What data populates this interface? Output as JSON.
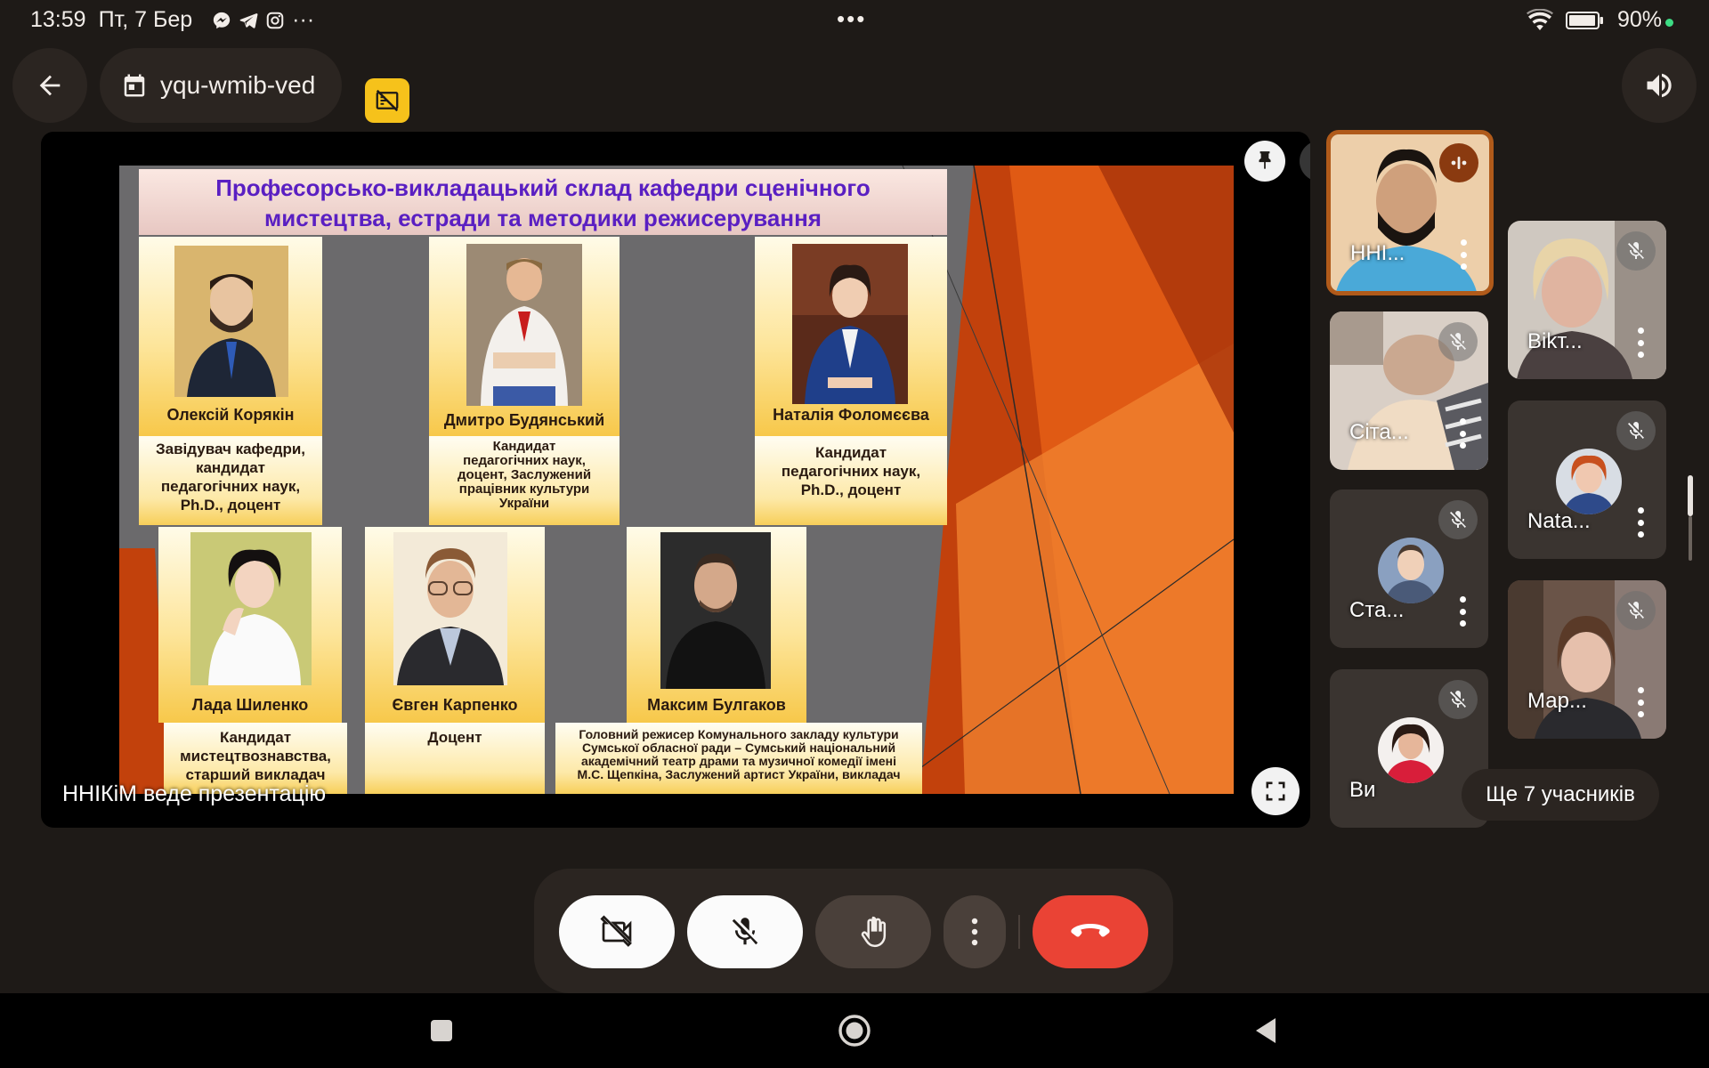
{
  "status_bar": {
    "time": "13:59",
    "date": "Пт, 7 Бер",
    "more_dots": "•••",
    "battery": "90%",
    "overflow": "···"
  },
  "meeting": {
    "code": "yqu-wmib-ved"
  },
  "presentation": {
    "presenter_label": "ННІКіМ веде презентацію",
    "slide": {
      "title_line1": "Професорсько-викладацький склад кафедри сценічного",
      "title_line2": "мистецтва, естради та методики режисерування",
      "people": [
        {
          "name": "Олексій  Корякін",
          "desc": [
            "Завідувач кафедри,",
            "кандидат",
            "педагогічних наук,",
            "Ph.D., доцент"
          ]
        },
        {
          "name": "Дмитро Будянський",
          "desc": [
            "Кандидат",
            "педагогічних наук,",
            "доцент, Заслужений",
            "працівник культури",
            "України"
          ]
        },
        {
          "name": "Наталія Фоломєєва",
          "desc": [
            "Кандидат",
            "педагогічних наук,",
            "Ph.D., доцент"
          ]
        },
        {
          "name": "Лада Шиленко",
          "desc": [
            "Кандидат",
            "мистецтвознавства,",
            "старший викладач"
          ]
        },
        {
          "name": "Євген Карпенко",
          "desc": [
            "Доцент"
          ]
        },
        {
          "name": "Максим Булгаков",
          "desc": [
            "Головний режисер Комунального закладу культури",
            "Сумської обласної ради – Сумський національний",
            "академічний театр драми та музичної комедії імені",
            "М.С. Щепкіна, Заслужений артист України, викладач"
          ]
        }
      ]
    }
  },
  "participants": [
    {
      "name": "ННІ...",
      "speaking": true
    },
    {
      "name": "Віkт..."
    },
    {
      "name": "Сіта..."
    },
    {
      "name": "Nata..."
    },
    {
      "name": "Ста..."
    },
    {
      "name": "Мар..."
    },
    {
      "name": "Ви"
    }
  ],
  "more_participants": "Ще 7 учасників",
  "colors": {
    "background": "#1e1a17",
    "end_call": "#ea4335",
    "no_camera_badge": "#f6c21b",
    "slide_title": "#5a1fc2",
    "active_tile_border": "#b05a1a"
  }
}
